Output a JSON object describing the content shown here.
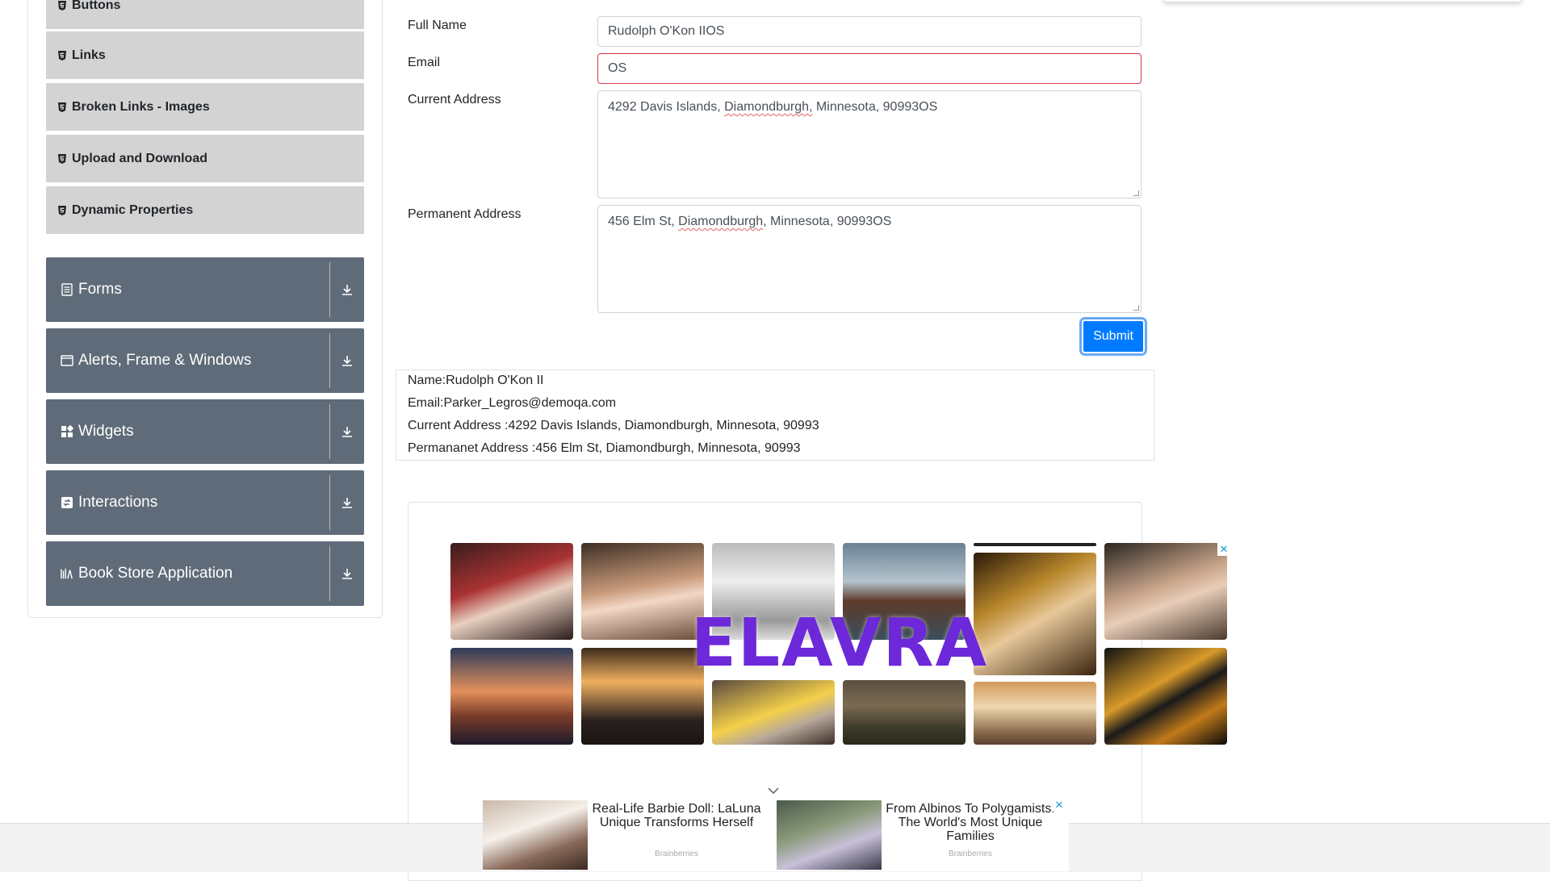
{
  "sidebar": {
    "elements_items": [
      {
        "label": "Buttons"
      },
      {
        "label": "Links"
      },
      {
        "label": "Broken Links - Images"
      },
      {
        "label": "Upload and Download"
      },
      {
        "label": "Dynamic Properties"
      }
    ],
    "groups": [
      {
        "label": "Forms",
        "icon": "form-icon"
      },
      {
        "label": "Alerts, Frame & Windows",
        "icon": "window-icon"
      },
      {
        "label": "Widgets",
        "icon": "widgets-icon"
      },
      {
        "label": "Interactions",
        "icon": "interactions-icon"
      },
      {
        "label": "Book Store Application",
        "icon": "bookstore-icon"
      }
    ]
  },
  "form": {
    "full_name_label": "Full Name",
    "full_name_value": "Rudolph O'Kon IIOS",
    "email_label": "Email",
    "email_value": "OS",
    "current_address_label": "Current Address",
    "current_address_parts": [
      "4292 Davis Islands, ",
      "Diamondburgh,",
      " Minnesota, 90993OS"
    ],
    "permanent_address_label": "Permanent Address",
    "permanent_address_parts": [
      "456 Elm St, ",
      "Diamondburgh",
      ", Minnesota, 90993OS"
    ],
    "submit_label": "Submit"
  },
  "output": {
    "name": "Name:Rudolph O'Kon II",
    "email": "Email:Parker_Legros@demoqa.com",
    "current_address": "Current Address :4292 Davis Islands, Diamondburgh, Minnesota, 90993",
    "permanent_address": "Permananet Address :456 Elm St, Diamondburgh, Minnesota, 90993"
  },
  "ad": {
    "brand": "ELAVRA",
    "close_glyph": "✕"
  },
  "bottom_ad": {
    "cards": [
      {
        "title": "Real-Life Barbie Doll: LaLuna Unique Transforms Herself",
        "source": "Brainberries"
      },
      {
        "title": "From Albinos To Polygamists: The World's Most Unique Families",
        "source": "Brainberries"
      }
    ],
    "close_glyph": "✕"
  },
  "colors": {
    "menu_item_bg": "#d3d3d3",
    "group_bg": "#5f6b78",
    "submit_bg": "#007bff",
    "error_border": "#dc3545",
    "brand_purple": "#6d28d9"
  }
}
